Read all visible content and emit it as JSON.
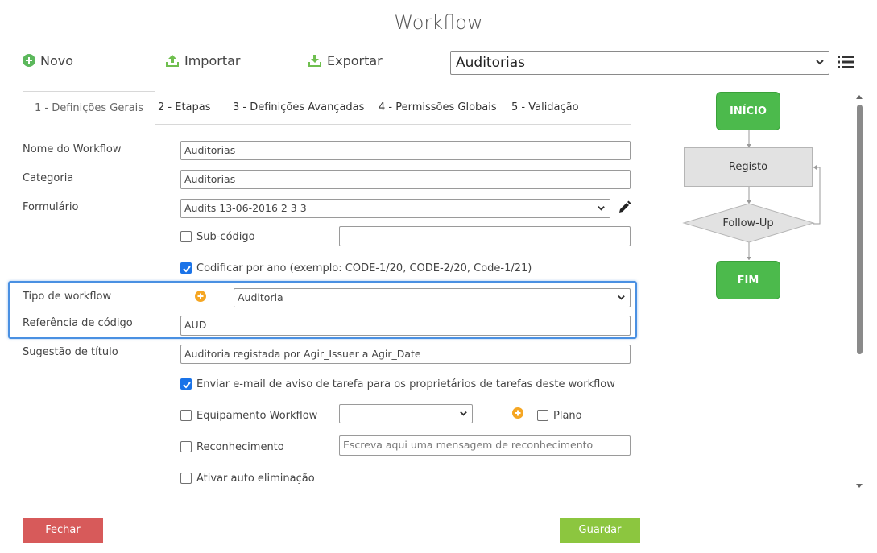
{
  "page": {
    "title": "Workflow"
  },
  "toolbar": {
    "novo_label": "Novo",
    "importar_label": "Importar",
    "exportar_label": "Exportar",
    "workflow_select_value": "Auditorias",
    "accent_green": "#4cba4c"
  },
  "tabs": [
    {
      "label": "1 - Definições Gerais",
      "active": true
    },
    {
      "label": "2 - Etapas"
    },
    {
      "label": "3 - Definições Avançadas"
    },
    {
      "label": "4 - Permissões Globais"
    },
    {
      "label": "5 - Validação"
    }
  ],
  "form": {
    "nome_label": "Nome do Workflow",
    "nome_value": "Auditorias",
    "categoria_label": "Categoria",
    "categoria_value": "Auditorias",
    "formulario_label": "Formulário",
    "formulario_value": "Audits 13-06-2016 2 3 3",
    "subcodigo_label": "Sub-código",
    "subcodigo_checked": false,
    "subcodigo_value": "",
    "codificar_label": "Codificar por ano (exemplo: CODE-1/20, CODE-2/20, Code-1/21)",
    "codificar_checked": true,
    "tipo_label": "Tipo de workflow",
    "tipo_value": "Auditoria",
    "referencia_label": "Referência de código",
    "referencia_value": "AUD",
    "sugestao_label": "Sugestão de título",
    "sugestao_value": "Auditoria registada por Agir_Issuer a Agir_Date",
    "enviar_label": "Enviar e-mail de aviso de tarefa para os proprietários de tarefas deste workflow",
    "enviar_checked": true,
    "equipamento_label": "Equipamento Workflow",
    "equipamento_checked": false,
    "equipamento_value": "",
    "plano_label": "Plano",
    "plano_checked": false,
    "reconhecimento_label": "Reconhecimento",
    "reconhecimento_checked": false,
    "reconhecimento_placeholder": "Escreva aqui uma mensagem de reconhecimento",
    "auto_label": "Ativar auto eliminação",
    "auto_checked": false
  },
  "flow": {
    "inicio": "INÍCIO",
    "registo": "Registo",
    "followup": "Follow-Up",
    "fim": "FIM"
  },
  "buttons": {
    "fechar": "Fechar",
    "guardar": "Guardar",
    "fechar_color": "#d75a5a",
    "guardar_color": "#8cc63f"
  }
}
